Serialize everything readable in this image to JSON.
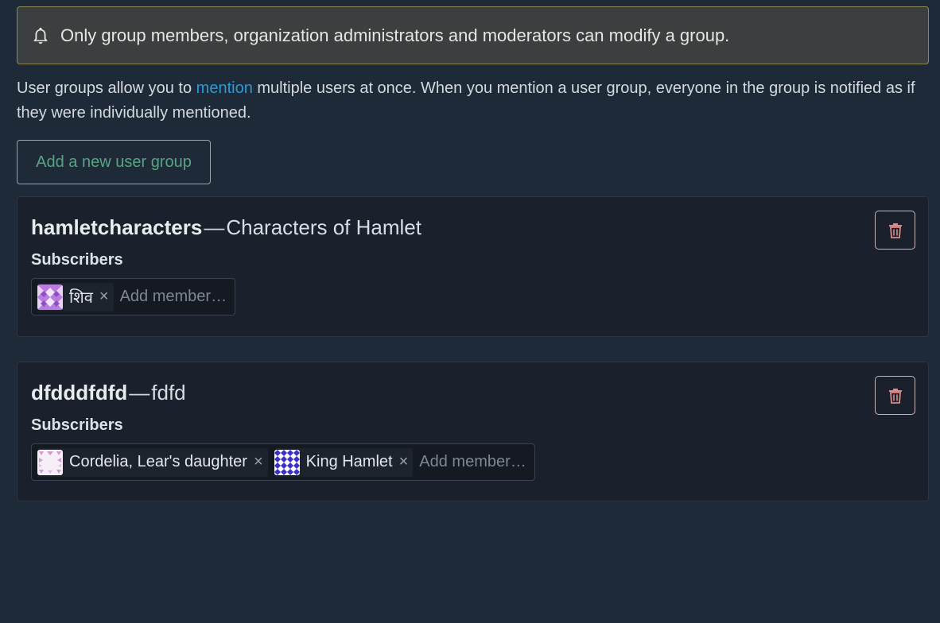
{
  "banner": {
    "icon": "bell-icon",
    "text": "Only group members, organization administrators and moderators can modify a group."
  },
  "description": {
    "before_link": "User groups allow you to ",
    "link_text": "mention",
    "after_link": " multiple users at once. When you mention a user group, everyone in the group is notified as if they were individually mentioned."
  },
  "add_group_button": "Add a new user group",
  "groups": [
    {
      "name": "hamletcharacters",
      "separator": "—",
      "description": "Characters of Hamlet",
      "subscribers_label": "Subscribers",
      "members": [
        {
          "name": "शिव",
          "remove": "×"
        }
      ],
      "add_member_placeholder": "Add member…"
    },
    {
      "name": "dfdddfdfd",
      "separator": "—",
      "description": "fdfd",
      "subscribers_label": "Subscribers",
      "members": [
        {
          "name": "Cordelia, Lear's daughter",
          "remove": "×"
        },
        {
          "name": "King Hamlet",
          "remove": "×"
        }
      ],
      "add_member_placeholder": "Add member…"
    }
  ],
  "colors": {
    "background": "#1f2a38",
    "banner_border": "#8f8a54",
    "link": "#2c9ad6",
    "add_button_text": "#56a482",
    "trash_icon": "#d98a8a"
  }
}
